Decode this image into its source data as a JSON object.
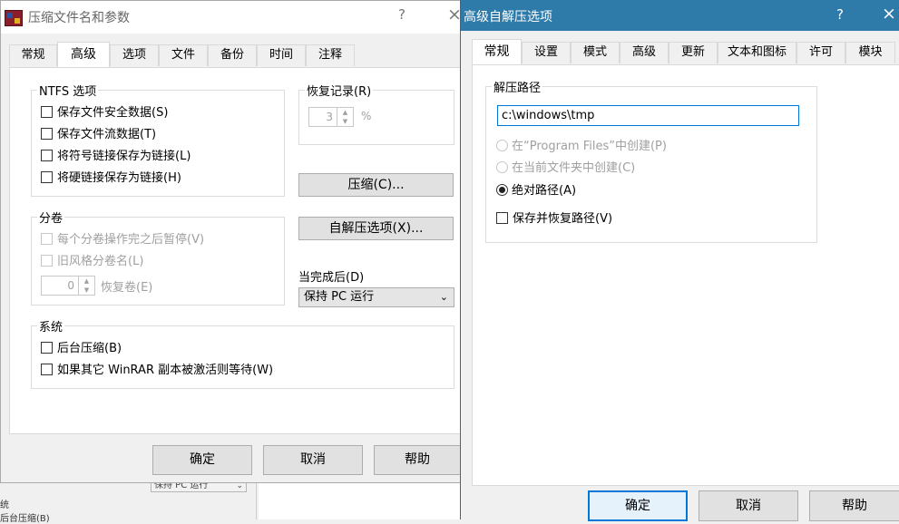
{
  "background_app": {
    "select_value": "保持 PC 运行",
    "label_system": "统",
    "label_bg_compress": "后台压缩(B)"
  },
  "dialog_main": {
    "title": "压缩文件名和参数",
    "help_glyph": "?",
    "close_glyph": "×",
    "tabs": [
      {
        "label": "常规"
      },
      {
        "label": "高级",
        "active": true
      },
      {
        "label": "选项"
      },
      {
        "label": "文件"
      },
      {
        "label": "备份"
      },
      {
        "label": "时间"
      },
      {
        "label": "注释"
      }
    ],
    "ntfs": {
      "title": "NTFS 选项",
      "options": [
        {
          "label": "保存文件安全数据(S)",
          "checked": false
        },
        {
          "label": "保存文件流数据(T)",
          "checked": false
        },
        {
          "label": "将符号链接保存为链接(L)",
          "checked": false
        },
        {
          "label": "将硬链接保存为链接(H)",
          "checked": false
        }
      ]
    },
    "recovery": {
      "title": "恢复记录(R)",
      "value": "3",
      "unit": "%"
    },
    "compress_button": "压缩(C)...",
    "sfx_options_button": "自解压选项(X)...",
    "volumes": {
      "title": "分卷",
      "pause_after_volume": "每个分卷操作完之后暂停(V)",
      "old_style_names": "旧风格分卷名(L)",
      "recovery_volumes_value": "0",
      "recovery_volumes_label": "恢复卷(E)"
    },
    "when_done": {
      "label": "当完成后(D)",
      "value": "保持 PC 运行"
    },
    "system": {
      "title": "系统",
      "background_compress": "后台压缩(B)",
      "wait_if_other_running": "如果其它 WinRAR 副本被激活则等待(W)"
    },
    "ok": "确定",
    "cancel": "取消",
    "help": "帮助"
  },
  "dialog_sfx": {
    "title": "高级自解压选项",
    "help_glyph": "?",
    "close_glyph": "×",
    "tabs": [
      {
        "label": "常规",
        "active": true
      },
      {
        "label": "设置"
      },
      {
        "label": "模式"
      },
      {
        "label": "高级"
      },
      {
        "label": "更新"
      },
      {
        "label": "文本和图标"
      },
      {
        "label": "许可"
      },
      {
        "label": "模块"
      }
    ],
    "extract_path": {
      "title": "解压路径",
      "value": "c:\\windows\\tmp",
      "radio_program_files": "在“Program Files”中创建(P)",
      "radio_current_folder": "在当前文件夹中创建(C)",
      "radio_absolute": "绝对路径(A)",
      "save_restore": "保存并恢复路径(V)",
      "selected": "absolute"
    },
    "ok": "确定",
    "cancel": "取消",
    "help": "帮助"
  },
  "colors": {
    "sfx_titlebar": "#2e7aa8",
    "focus_blue": "#0078d7",
    "dialog_bg": "#f0f0f0"
  }
}
